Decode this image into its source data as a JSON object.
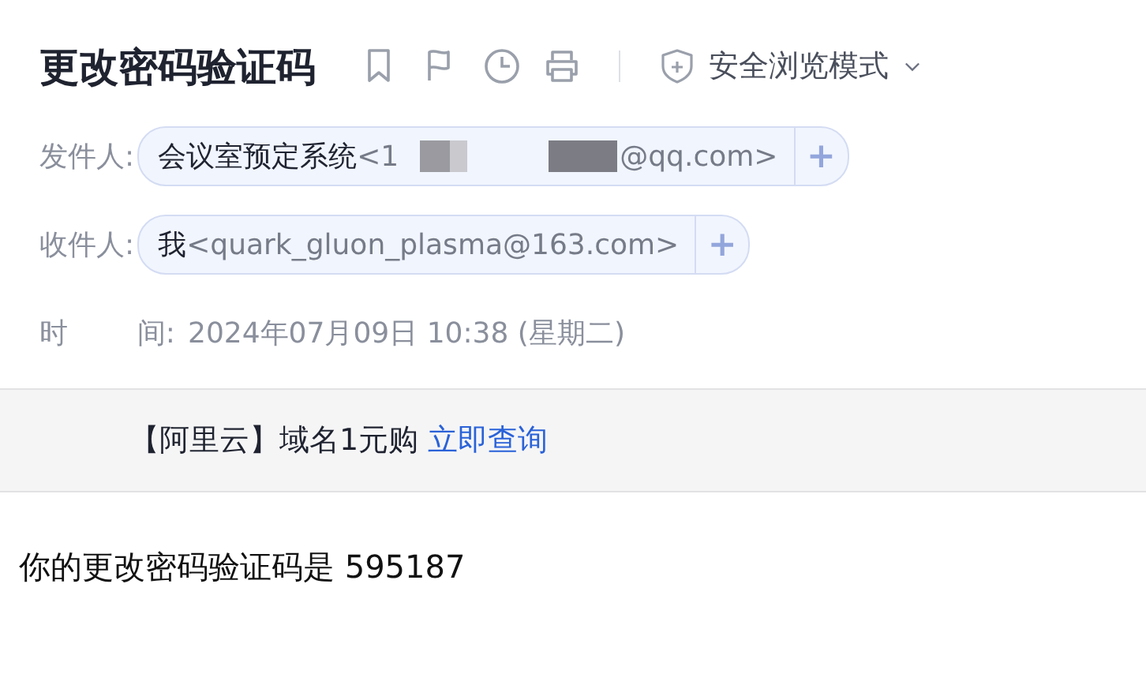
{
  "subject": "更改密码验证码",
  "toolbar": {
    "safe_mode": "安全浏览模式"
  },
  "sender": {
    "label": "发件人:",
    "name": "会议室预定系统",
    "address_start": "<1",
    "redacted": true,
    "address_end": "@qq.com>",
    "add": "+"
  },
  "recipient": {
    "label": "收件人:",
    "name": "我",
    "address": "<quark_gluon_plasma@163.com>",
    "add": "+"
  },
  "time": {
    "label_start": "时",
    "label_end": "间:",
    "value": "2024年07月09日 10:38 (星期二)"
  },
  "ad": {
    "text": "【阿里云】域名1元购",
    "link": "立即查询"
  },
  "body": "你的更改密码验证码是 595187"
}
